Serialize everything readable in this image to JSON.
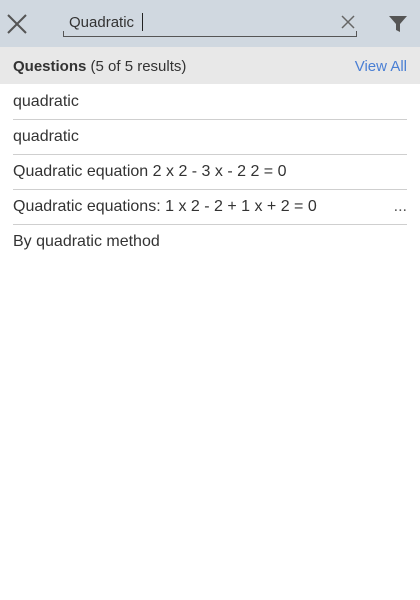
{
  "search": {
    "value": "Quadratic",
    "clear_icon": "close-icon",
    "close_icon": "close-icon",
    "filter_icon": "filter-icon"
  },
  "section": {
    "title": "Questions",
    "count_text": "(5 of 5 results)",
    "view_all_label": "View All"
  },
  "results": [
    {
      "text": "quadratic"
    },
    {
      "text": "quadratic"
    },
    {
      "text": "Quadratic equation 2 x 2 - 3 x - 2 2 = 0"
    },
    {
      "text": "Quadratic equations: 1   x 2 - 2 + 1 x + 2 = 0",
      "more": "..."
    },
    {
      "text": "By quadratic method"
    }
  ],
  "colors": {
    "topbar_bg": "#d0d8e0",
    "header_bg": "#e8e8e8",
    "link": "#4a7fd4"
  }
}
